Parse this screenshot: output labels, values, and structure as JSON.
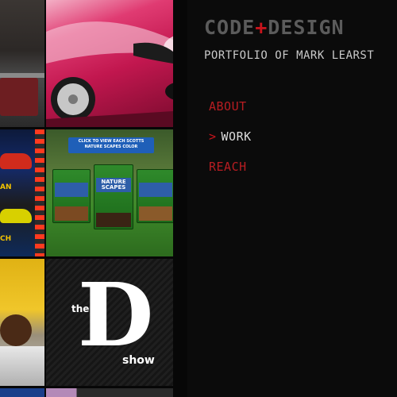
{
  "site": {
    "logo_left": "CODE",
    "logo_plus": "+",
    "logo_right": "DESIGN",
    "subtitle": "PORTFOLIO OF MARK LEARST"
  },
  "nav": {
    "items": [
      {
        "label": "ABOUT",
        "active": false
      },
      {
        "label": "WORK",
        "active": true
      },
      {
        "label": "REACH",
        "active": false
      }
    ],
    "active_marker": ">"
  },
  "tiles": {
    "scotts_banner": "CLICK TO VIEW EACH SCOTTS NATURE SCAPES COLOR",
    "scotts_product": "NATURE SCAPES",
    "dshow_the": "the",
    "dshow_letter": "D",
    "dshow_show": "show",
    "game_label_1": "AN",
    "game_label_2": "CH"
  },
  "colors": {
    "accent_red": "#c8141c",
    "nav_red": "#b81d22",
    "logo_gray": "#5b5b5b",
    "background": "#0b0b0b"
  }
}
